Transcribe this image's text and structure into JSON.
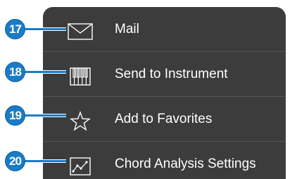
{
  "menu": {
    "items": [
      {
        "label": "Mail",
        "icon": "mail-envelope-icon",
        "callout": "17"
      },
      {
        "label": "Send to Instrument",
        "icon": "piano-keyboard-icon",
        "callout": "18"
      },
      {
        "label": "Add to Favorites",
        "icon": "star-outline-icon",
        "callout": "19"
      },
      {
        "label": "Chord Analysis Settings",
        "icon": "chord-analysis-graph-icon",
        "callout": "20"
      }
    ]
  },
  "colors": {
    "menu_background": "#3c3c3c",
    "menu_text": "#ffffff",
    "divider": "#555555",
    "callout_blue": "#1a7cc6"
  }
}
